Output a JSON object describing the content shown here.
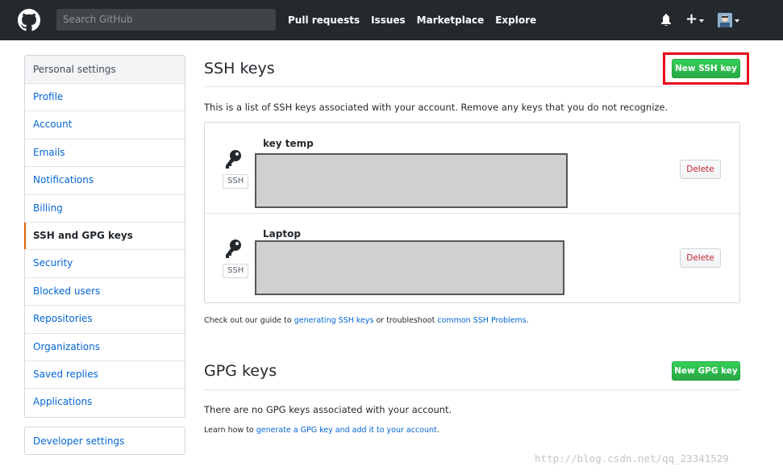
{
  "header": {
    "search_placeholder": "Search GitHub",
    "nav": [
      "Pull requests",
      "Issues",
      "Marketplace",
      "Explore"
    ],
    "icons": {
      "logo": "github-octocat-icon",
      "notifications": "bell-icon",
      "create": "plus-icon",
      "user": "avatar"
    }
  },
  "sidebar": {
    "heading": "Personal settings",
    "items": [
      {
        "label": "Profile"
      },
      {
        "label": "Account"
      },
      {
        "label": "Emails"
      },
      {
        "label": "Notifications"
      },
      {
        "label": "Billing"
      },
      {
        "label": "SSH and GPG keys",
        "selected": true
      },
      {
        "label": "Security"
      },
      {
        "label": "Blocked users"
      },
      {
        "label": "Repositories"
      },
      {
        "label": "Organizations"
      },
      {
        "label": "Saved replies"
      },
      {
        "label": "Applications"
      }
    ],
    "developer_settings": "Developer settings"
  },
  "ssh": {
    "title": "SSH keys",
    "new_button": "New SSH key",
    "intro": "This is a list of SSH keys associated with your account. Remove any keys that you do not recognize.",
    "keys": [
      {
        "name": "key temp",
        "type": "SSH",
        "delete": "Delete"
      },
      {
        "name": "Laptop",
        "type": "SSH",
        "delete": "Delete"
      }
    ],
    "guide": {
      "prefix": "Check out our guide to ",
      "link1": "generating SSH keys",
      "middle": " or troubleshoot ",
      "link2": "common SSH Problems",
      "suffix": "."
    }
  },
  "gpg": {
    "title": "GPG keys",
    "new_button": "New GPG key",
    "empty": "There are no GPG keys associated with your account.",
    "learn": {
      "prefix": "Learn how to ",
      "link": "generate a GPG key and add it to your account",
      "suffix": "."
    }
  },
  "watermark": "http://blog.csdn.net/qq_23341529",
  "colors": {
    "header_bg": "#24292e",
    "link": "#0366d6",
    "green_button": "#28a745",
    "delete_text": "#cb2431",
    "selected_marker": "#e36209",
    "highlight_box": "#e8001c"
  }
}
